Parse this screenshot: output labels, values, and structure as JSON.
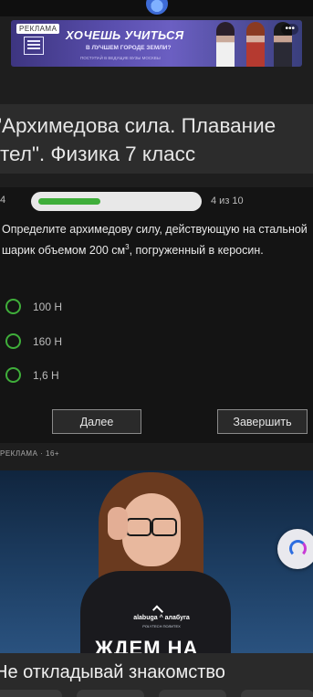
{
  "top_ad": {
    "badge": "РЕКЛАМА",
    "title": "ХОЧЕШЬ УЧИТЬСЯ",
    "subtitle": "В ЛУЧШЕМ ГОРОДЕ ЗЕМЛИ?",
    "fine_print": "ПОСТУПАЙ В ВЕДУЩИЕ ВУЗЫ МОСКВЫ",
    "more": "•••"
  },
  "page": {
    "title": "\"Архимедова сила. Плавание тел\". Физика 7 класс"
  },
  "quiz": {
    "question_number": "4",
    "progress": {
      "current": 4,
      "total": 10,
      "fraction": 0.4,
      "label": "4 из 10"
    },
    "question_text_before": "Определите архимедову силу, действующую на стальной шарик объемом 200 см",
    "question_sup": "3",
    "question_text_after": ", погруженный в керосин.",
    "options": [
      "100 Н",
      "160 Н",
      "1,6 Н"
    ],
    "buttons": {
      "next": "Далее",
      "finish": "Завершить"
    },
    "accent_color": "#3fae3a"
  },
  "ad_section": {
    "label": "РЕКЛАМА · 16+",
    "brand": "alabuga ^ алабуга",
    "brand_sub": "POLYTECH  ПОЛИТЕХ",
    "headline": "ЖДЕМ НА"
  },
  "bottom": {
    "title": "Не откладывай знакомство"
  }
}
